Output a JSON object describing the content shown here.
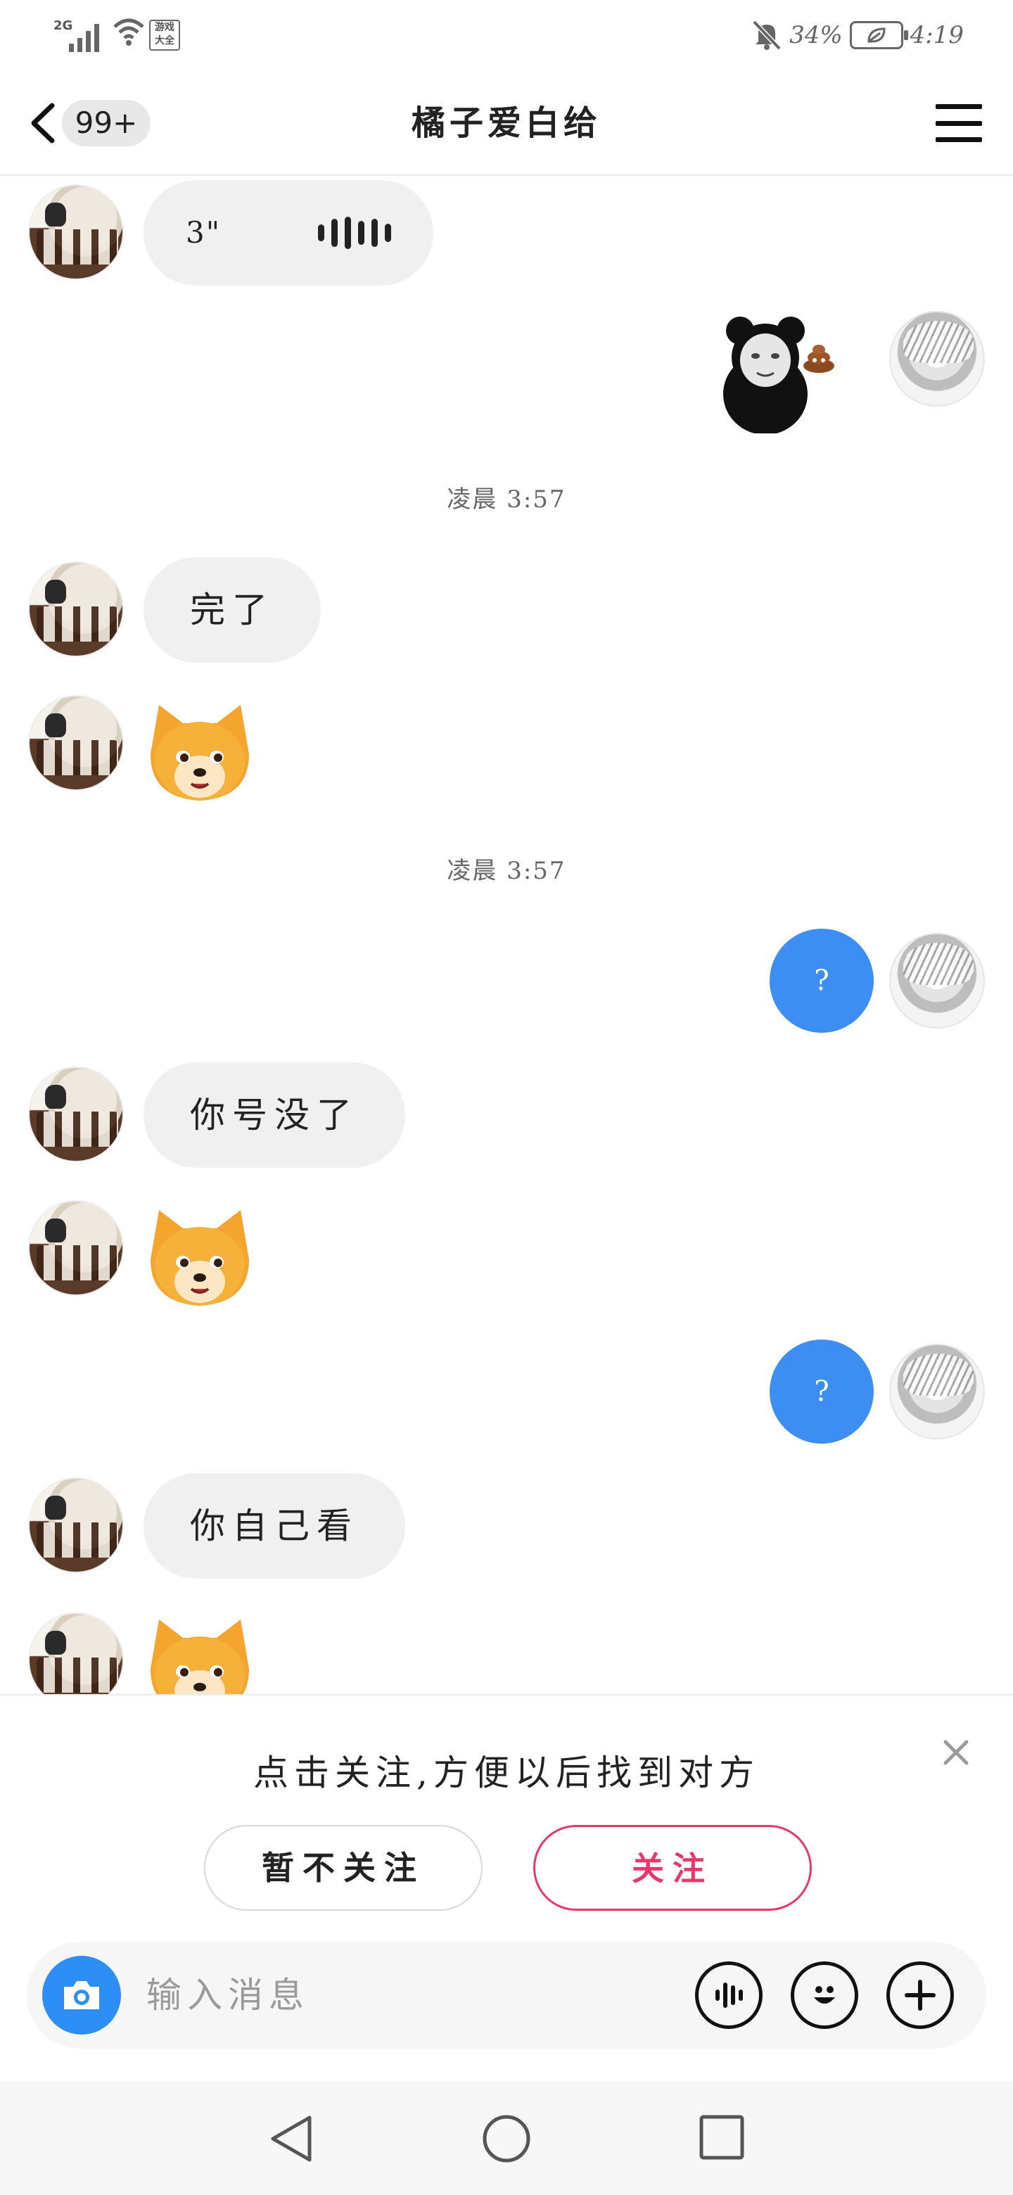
{
  "status_bar": {
    "network": "2G",
    "app_icon_text": "游戏\n大全",
    "battery": "34%",
    "time": "4:19"
  },
  "nav": {
    "unread_count": "99+",
    "title": "橘子爱白给"
  },
  "messages": {
    "voice_duration": "3\"",
    "ts1": "凌晨 3:57",
    "m1": "完了",
    "ts2": "凌晨 3:57",
    "q1": "?",
    "m2": "你号没了",
    "q2": "?",
    "m3": "你自己看"
  },
  "follow_prompt": {
    "text": "点击关注,方便以后找到对方",
    "skip_label": "暂不关注",
    "follow_label": "关注"
  },
  "input": {
    "placeholder": "输入消息"
  },
  "colors": {
    "bubble_blue": "#3d8ef2",
    "follow_pink": "#e8386a",
    "camera_blue": "#2d8ef6"
  }
}
